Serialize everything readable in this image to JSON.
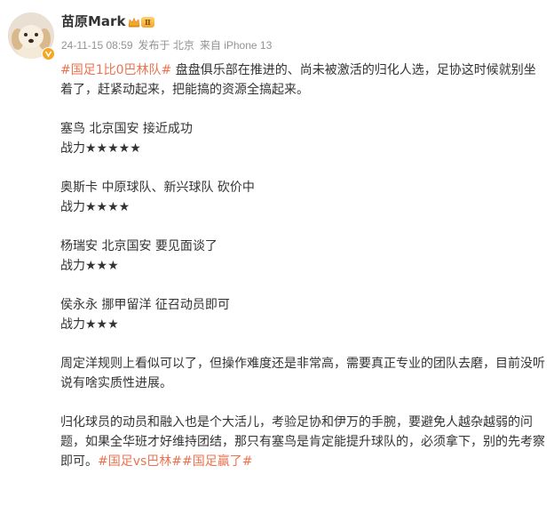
{
  "user": {
    "name": "苗原Mark",
    "vip_level": "Ⅱ",
    "avatar_icon": "dog-avatar-icon",
    "verified_badge_icon": "verified-v-icon"
  },
  "meta": {
    "time": "24-11-15 08:59",
    "location": "发布于 北京",
    "source": "来自 iPhone 13"
  },
  "post": {
    "intro_hashtag": "#国足1比0巴林队#",
    "intro_text": " 盘盘俱乐部在推进的、尚未被激活的归化人选，足协这时候就别坐着了，赶紧动起来，把能搞的资源全搞起来。",
    "candidates": [
      {
        "line1": "塞鸟 北京国安 接近成功",
        "line2": "战力★★★★★"
      },
      {
        "line1": "奥斯卡 中原球队、新兴球队 砍价中",
        "line2": "战力★★★★"
      },
      {
        "line1": "杨瑞安 北京国安 要见面谈了",
        "line2": "战力★★★"
      },
      {
        "line1": "侯永永 挪甲留洋 征召动员即可",
        "line2": "战力★★★"
      }
    ],
    "paragraph_rules": "周定洋规则上看似可以了，但操作难度还是非常高，需要真正专业的团队去磨，目前没听说有啥实质性进展。",
    "paragraph_final": "归化球员的动员和融入也是个大活儿，考验足协和伊万的手腕，要避免人越杂越弱的问题，如果全华班才好维持团结，那只有塞鸟是肯定能提升球队的，必须拿下，别的先考察即可。",
    "hashtag_1": "#国足vs巴林#",
    "hashtag_2": "#国足赢了#"
  },
  "colors": {
    "hashtag": "#eb7350",
    "meta": "#939393",
    "text": "#333333",
    "vip_gold": "#f2a72e"
  }
}
